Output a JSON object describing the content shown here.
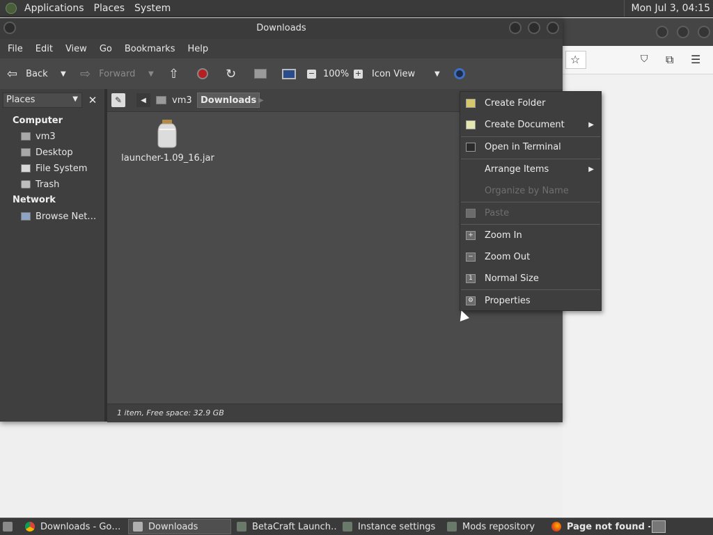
{
  "top_panel": {
    "menu": [
      "Applications",
      "Places",
      "System"
    ],
    "clock": "Mon Jul  3, 04:15"
  },
  "window": {
    "title": "Downloads",
    "menubar": [
      "File",
      "Edit",
      "View",
      "Go",
      "Bookmarks",
      "Help"
    ]
  },
  "toolbar": {
    "back": "Back",
    "forward": "Forward",
    "zoom": "100%",
    "view_mode": "Icon View"
  },
  "sidebar": {
    "combo": "Places",
    "sections": [
      {
        "title": "Computer",
        "items": [
          "vm3",
          "Desktop",
          "File System",
          "Trash"
        ]
      },
      {
        "title": "Network",
        "items": [
          "Browse Net…"
        ]
      }
    ]
  },
  "pathbar": {
    "crumbs": [
      "vm3",
      "Downloads"
    ]
  },
  "files": [
    {
      "name": "launcher-1.09_16.jar",
      "icon": "jar-file-icon"
    }
  ],
  "status": "1 item, Free space: 32.9 GB",
  "context_menu": {
    "items": [
      {
        "label": "Create Folder",
        "icon": "folder-new-icon",
        "submenu": false,
        "enabled": true
      },
      {
        "label": "Create Document",
        "icon": "document-new-icon",
        "submenu": true,
        "enabled": true
      },
      {
        "label": "Open in Terminal",
        "icon": "terminal-icon",
        "submenu": false,
        "enabled": true
      },
      {
        "label": "Arrange Items",
        "icon": "",
        "submenu": true,
        "enabled": true
      },
      {
        "label": "Organize by Name",
        "icon": "",
        "submenu": false,
        "enabled": false
      },
      {
        "label": "Paste",
        "icon": "paste-icon",
        "submenu": false,
        "enabled": false
      },
      {
        "label": "Zoom In",
        "icon": "zoom-in-icon",
        "submenu": false,
        "enabled": true
      },
      {
        "label": "Zoom Out",
        "icon": "zoom-out-icon",
        "submenu": false,
        "enabled": true
      },
      {
        "label": "Normal Size",
        "icon": "zoom-normal-icon",
        "submenu": false,
        "enabled": true
      },
      {
        "label": "Properties",
        "icon": "properties-icon",
        "submenu": false,
        "enabled": true
      }
    ]
  },
  "taskbar": [
    {
      "label": "Downloads - Go…",
      "icon": "chrome-icon",
      "active": false,
      "bold": false
    },
    {
      "label": "Downloads",
      "icon": "folder-icon",
      "active": true,
      "bold": false
    },
    {
      "label": "BetaCraft Launch…",
      "icon": "java-icon",
      "active": false,
      "bold": false
    },
    {
      "label": "Instance settings",
      "icon": "java-icon",
      "active": false,
      "bold": false
    },
    {
      "label": "Mods repository",
      "icon": "java-icon",
      "active": false,
      "bold": false
    },
    {
      "label": "Page not found - …",
      "icon": "firefox-icon",
      "active": false,
      "bold": true
    }
  ],
  "colors": {
    "panel": "#3a3a3a",
    "window_bg": "#4b4b4b",
    "desktop": "#efefef"
  }
}
